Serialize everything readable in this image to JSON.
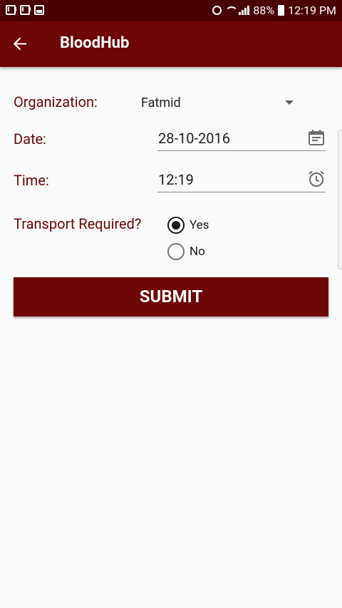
{
  "status_bar": {
    "battery": "88%",
    "time": "12:19 PM",
    "icons": [
      "mail-icon",
      "mail-icon",
      "gallery-icon",
      "alarm-icon",
      "wifi-icon",
      "signal-icon",
      "battery-icon"
    ]
  },
  "app_bar": {
    "title": "BloodHub",
    "back_icon": "arrow-left-icon"
  },
  "form": {
    "organization_label": "Organization:",
    "organization_value": "Fatmid",
    "date_label": "Date:",
    "date_value": "28-10-2016",
    "time_label": "Time:",
    "time_value": "12:19",
    "transport_label": "Transport Required?",
    "transport_options": [
      {
        "label": "Yes",
        "checked": true
      },
      {
        "label": "No",
        "checked": false
      }
    ],
    "submit_label": "SUBMIT"
  },
  "colors": {
    "primary": "#6e0606",
    "status_bar": "#4a0000",
    "background": "#fafafa"
  }
}
